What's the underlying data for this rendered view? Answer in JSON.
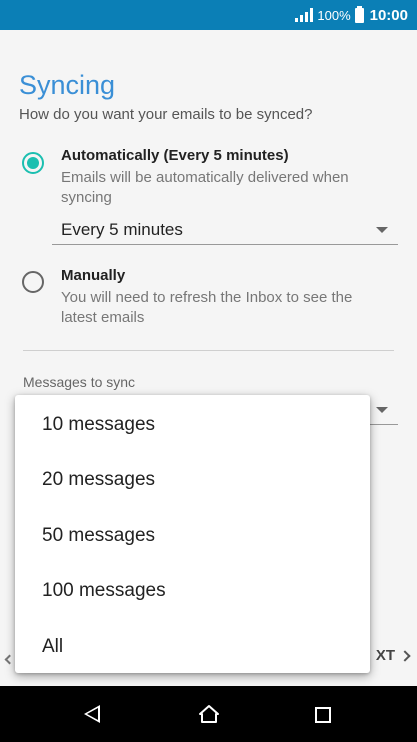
{
  "status_bar": {
    "battery_percent": "100%",
    "time": "10:00"
  },
  "page": {
    "title": "Syncing",
    "subtitle": "How do you want your emails to be synced?"
  },
  "options": {
    "automatic": {
      "title": "Automatically (Every 5 minutes)",
      "description": "Emails will be automatically delivered when syncing",
      "selected": true,
      "interval_value": "Every 5 minutes"
    },
    "manual": {
      "title": "Manually",
      "description": "You will need to refresh the Inbox to see the latest emails",
      "selected": false
    }
  },
  "messages_to_sync": {
    "label": "Messages to sync"
  },
  "footer": {
    "next_label": "XT"
  },
  "dropdown": {
    "items": [
      "10 messages",
      "20 messages",
      "50 messages",
      "100 messages",
      "All"
    ]
  },
  "colors": {
    "status_bar": "#0b7fb6",
    "accent": "#3a8fd6",
    "radio_on": "#1bbfb0"
  },
  "icons": {
    "signal": "signal-icon",
    "battery": "battery-icon",
    "back": "back-icon",
    "home": "home-icon",
    "recents": "recents-icon"
  }
}
